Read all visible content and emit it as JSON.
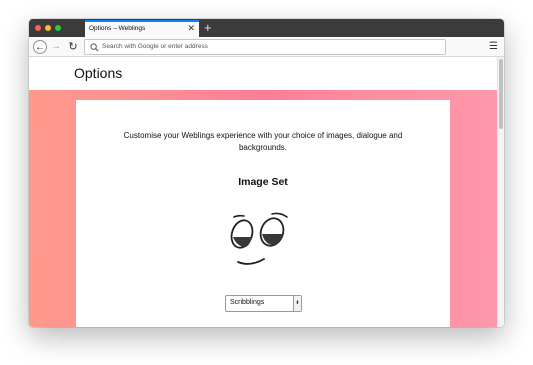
{
  "browser": {
    "tab_title": "Options – Weblings",
    "tab_close_glyph": "✕",
    "new_tab_glyph": "+",
    "back_glyph": "←",
    "forward_glyph": "→",
    "reload_glyph": "↻",
    "menu_glyph": "☰",
    "url_placeholder": "Search with Google or enter address",
    "icons": [
      "back-arrow-icon",
      "forward-arrow-icon",
      "reload-icon",
      "search-icon",
      "hamburger-menu-icon",
      "close-icon",
      "plus-icon"
    ],
    "accent_color": "#0a84ff"
  },
  "page": {
    "title": "Options",
    "intro": "Customise your Weblings experience with your choice of images, dialogue and backgrounds.",
    "image_set_heading": "Image Set",
    "image_set_select": {
      "selected": "Scribblings",
      "arrow_glyph": "⬍"
    },
    "gradient_colors": [
      "#fe9a8c",
      "#fd7d98",
      "#fe98ac"
    ]
  }
}
